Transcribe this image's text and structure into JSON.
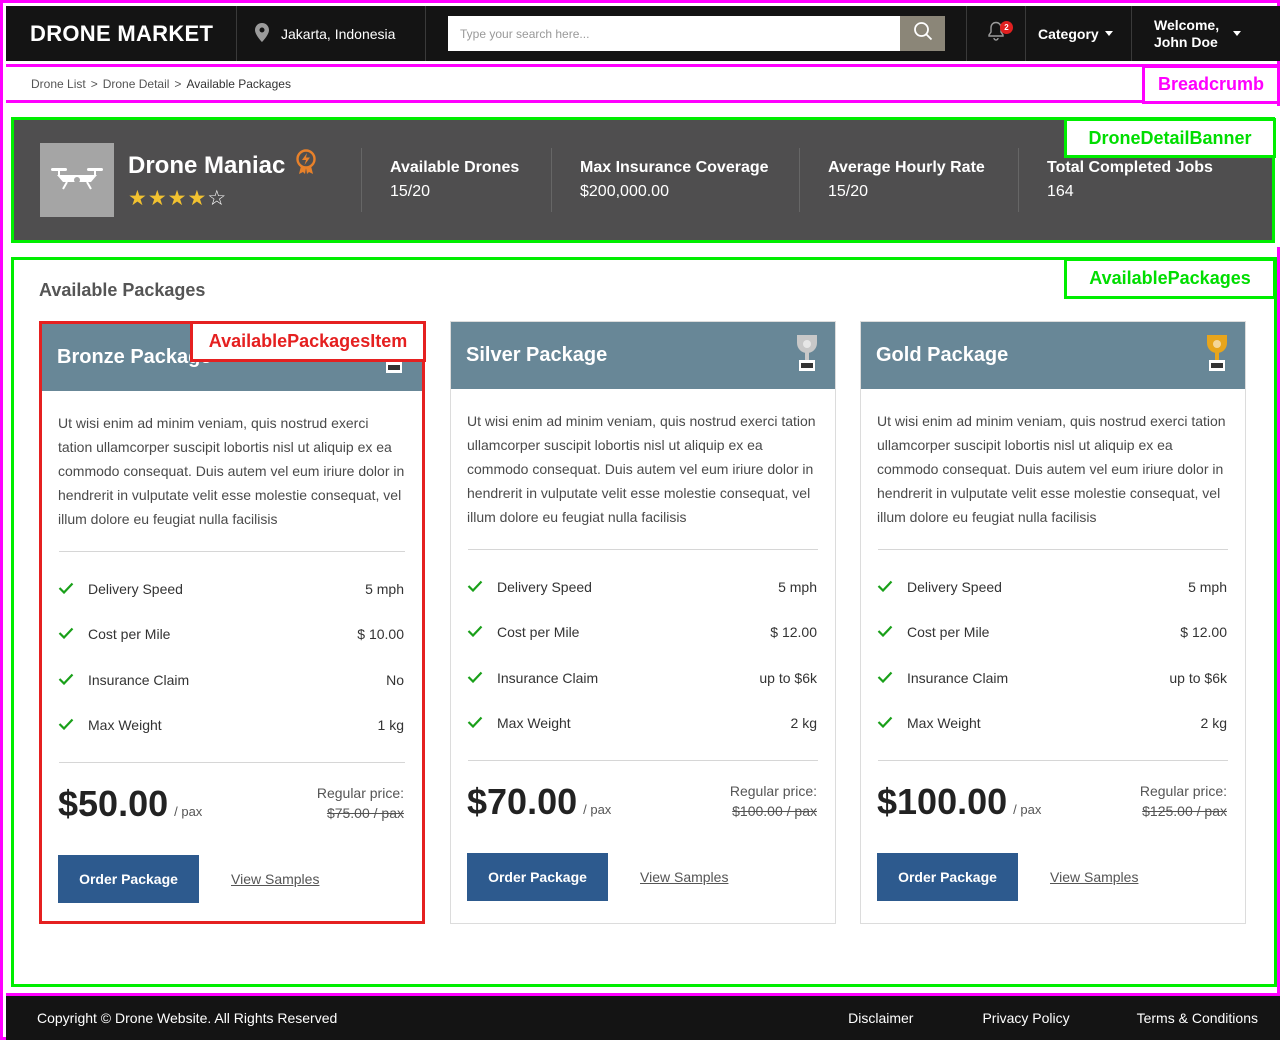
{
  "header": {
    "logo": "DRONE MARKET",
    "location": "Jakarta, Indonesia",
    "search_placeholder": "Type your search here...",
    "notification_count": "2",
    "category_label": "Category",
    "welcome_line1": "Welcome,",
    "welcome_line2": "John Doe"
  },
  "breadcrumb": {
    "items": [
      "Drone List",
      "Drone Detail",
      "Available Packages"
    ],
    "separator": ">"
  },
  "annotations": {
    "breadcrumb": "Breadcrumb",
    "banner": "DroneDetailBanner",
    "packages": "AvailablePackages",
    "item": "AvailablePackagesItem"
  },
  "banner": {
    "name": "Drone Maniac",
    "rating": 4,
    "rating_max": 5,
    "stats": [
      {
        "label": "Available Drones",
        "value": "15/20"
      },
      {
        "label": "Max Insurance Coverage",
        "value": "$200,000.00"
      },
      {
        "label": "Average Hourly Rate",
        "value": "15/20"
      },
      {
        "label": "Total Completed Jobs",
        "value": "164"
      }
    ]
  },
  "packages": {
    "title": "Available Packages",
    "items": [
      {
        "name": "Bronze Package",
        "trophy_color": "#9a9a9a",
        "description": "Ut wisi enim ad minim veniam, quis nostrud exerci tation ullamcorper suscipit lobortis nisl ut aliquip ex ea commodo consequat. Duis autem vel eum iriure dolor in hendrerit in vulputate velit esse molestie consequat, vel illum dolore eu feugiat nulla facilisis",
        "features": [
          {
            "name": "Delivery Speed",
            "value": "5 mph"
          },
          {
            "name": "Cost per Mile",
            "value": "$ 10.00"
          },
          {
            "name": "Insurance Claim",
            "value": "No"
          },
          {
            "name": "Max Weight",
            "value": "1 kg"
          }
        ],
        "price": "$50.00",
        "per": "/ pax",
        "regular_label": "Regular price:",
        "regular_price": "$75.00 / pax",
        "order_label": "Order Package",
        "samples_label": "View Samples"
      },
      {
        "name": "Silver Package",
        "trophy_color": "#c8c8c8",
        "description": "Ut wisi enim ad minim veniam, quis nostrud exerci tation ullamcorper suscipit lobortis nisl ut aliquip ex ea commodo consequat. Duis autem vel eum iriure dolor in hendrerit in vulputate velit esse molestie consequat, vel illum dolore eu feugiat nulla facilisis",
        "features": [
          {
            "name": "Delivery Speed",
            "value": "5 mph"
          },
          {
            "name": "Cost per Mile",
            "value": "$ 12.00"
          },
          {
            "name": "Insurance Claim",
            "value": "up to $6k"
          },
          {
            "name": "Max Weight",
            "value": "2 kg"
          }
        ],
        "price": "$70.00",
        "per": "/ pax",
        "regular_label": "Regular price:",
        "regular_price": "$100.00 / pax",
        "order_label": "Order Package",
        "samples_label": "View Samples"
      },
      {
        "name": "Gold Package",
        "trophy_color": "#e8a51c",
        "description": "Ut wisi enim ad minim veniam, quis nostrud exerci tation ullamcorper suscipit lobortis nisl ut aliquip ex ea commodo consequat. Duis autem vel eum iriure dolor in hendrerit in vulputate velit esse molestie consequat, vel illum dolore eu feugiat nulla facilisis",
        "features": [
          {
            "name": "Delivery Speed",
            "value": "5 mph"
          },
          {
            "name": "Cost per Mile",
            "value": "$ 12.00"
          },
          {
            "name": "Insurance Claim",
            "value": "up to $6k"
          },
          {
            "name": "Max Weight",
            "value": "2 kg"
          }
        ],
        "price": "$100.00",
        "per": "/ pax",
        "regular_label": "Regular price:",
        "regular_price": "$125.00 / pax",
        "order_label": "Order Package",
        "samples_label": "View Samples"
      }
    ]
  },
  "footer": {
    "copyright": "Copyright © Drone Website. All Rights Reserved",
    "links": [
      "Disclaimer",
      "Privacy Policy",
      "Terms & Conditions"
    ]
  },
  "colors": {
    "header_bg": "#141414",
    "banner_bg": "#4f4e4f",
    "card_header": "#688797",
    "order_button": "#2d5a8e",
    "check": "#1aa01a",
    "star": "#f2c230",
    "badge_orange": "#e8812a"
  }
}
